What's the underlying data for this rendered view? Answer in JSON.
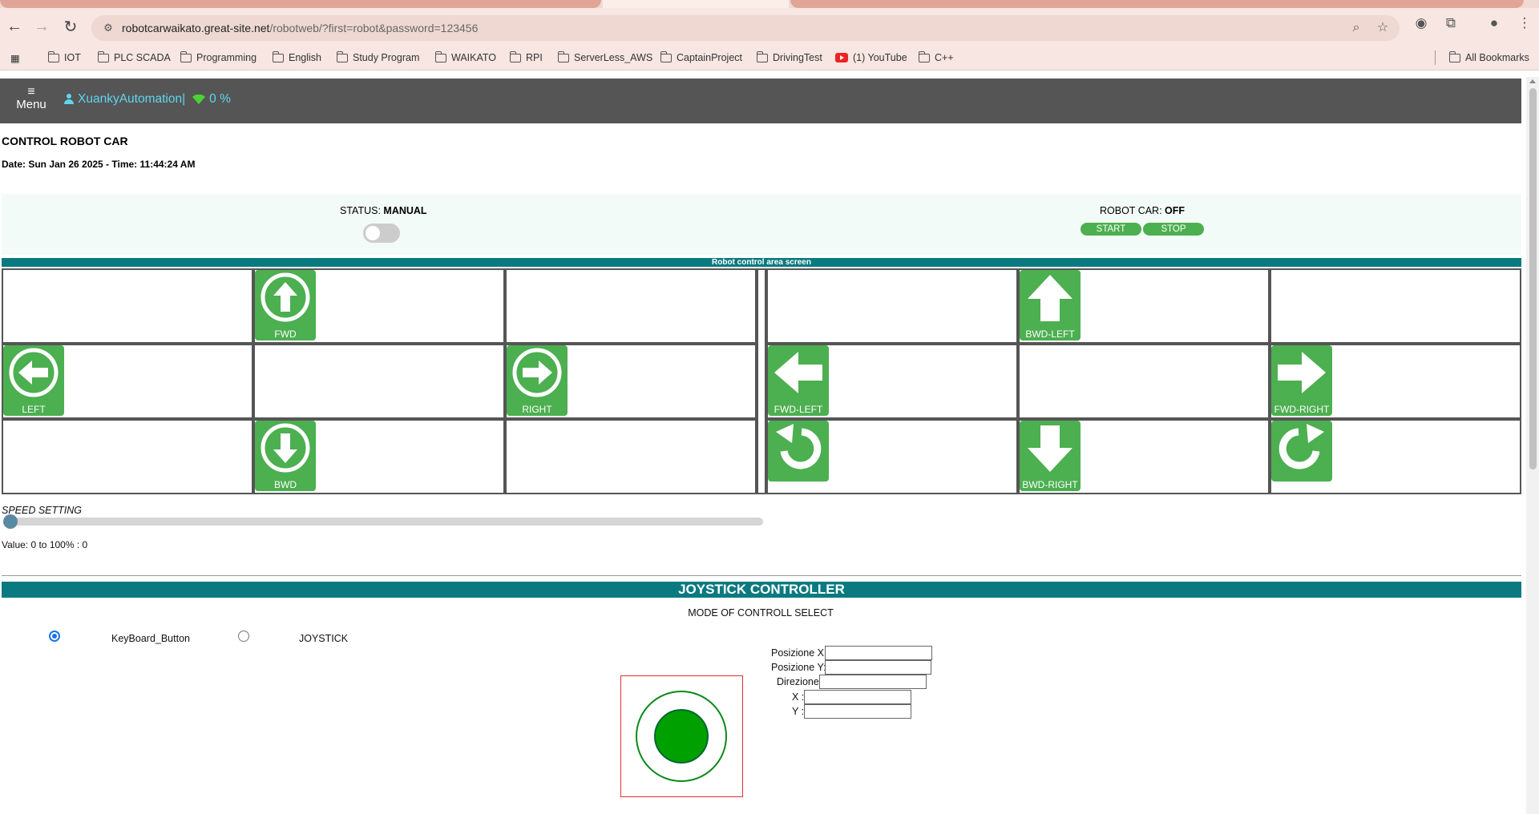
{
  "browser": {
    "url_host": "robotcarwaikato.great-site.net",
    "url_path": "/robotweb/?first=robot&password=123456",
    "bookmarks": [
      "IOT",
      "PLC SCADA",
      "Programming",
      "English",
      "Study Program",
      "WAIKATO",
      "RPI",
      "ServerLess_AWS",
      "CaptainProject",
      "DrivingTest",
      "(1) YouTube",
      "C++"
    ],
    "all_bookmarks": "All Bookmarks"
  },
  "nav": {
    "menu_label": "Menu",
    "user": "XuankyAutomation|",
    "signal": "0 %"
  },
  "header": {
    "title": "CONTROL ROBOT CAR",
    "datetime": "Date: Sun Jan 26 2025 - Time: 11:44:24 AM"
  },
  "status": {
    "status_label": "STATUS: ",
    "status_value": "MANUAL",
    "mode_toggle_on": false,
    "car_label": "ROBOT CAR: ",
    "car_value": "OFF",
    "start": "START",
    "stop": "STOP"
  },
  "control_area": {
    "banner": "Robot control area screen",
    "left_pad": {
      "fwd": "FWD",
      "left": "LEFT",
      "right": "RIGHT",
      "bwd": "BWD"
    },
    "right_pad": {
      "bwd_left": "BWD-LEFT",
      "fwd_left": "FWD-LEFT",
      "fwd_right": "FWD-RIGHT",
      "bwd_right": "BWD-RIGHT"
    }
  },
  "speed": {
    "label": "SPEED SETTING",
    "value_text": "Value: 0 to 100% : 0",
    "value_percent": 0
  },
  "joystick": {
    "banner": "JOYSTICK CONTROLLER",
    "mode_label": "MODE OF CONTROLL SELECT",
    "option_keyboard": "KeyBoard_Button",
    "option_joystick": "JOYSTICK",
    "selected": "KeyBoard_Button",
    "pos_x_label": "Posizione X:",
    "pos_y_label": "Posizione Y:",
    "direction_label": "Direzione:",
    "x_label": "X :",
    "y_label": "Y :",
    "pos_x_value": "",
    "pos_y_value": "",
    "direction_value": "",
    "x_value": "",
    "y_value": ""
  },
  "colors": {
    "control_green": "#4caf50",
    "teal_banner": "#0a7a80",
    "nav_bg": "#555555",
    "nav_text": "#5fd6ef"
  }
}
